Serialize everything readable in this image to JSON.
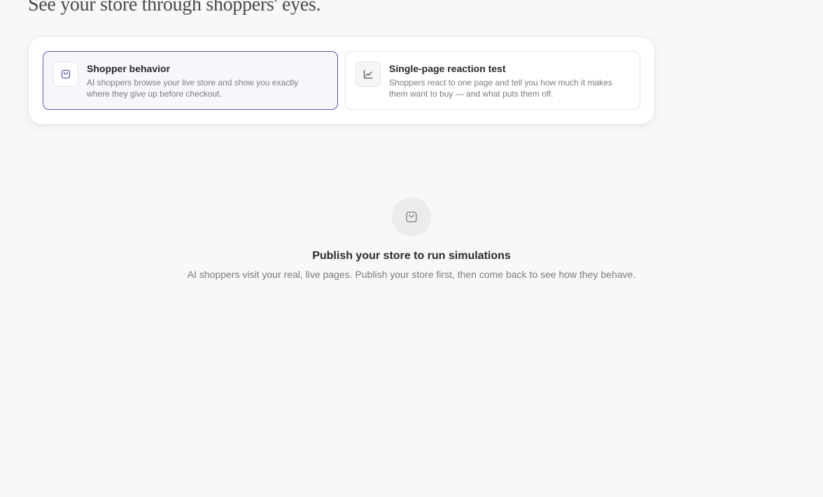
{
  "header": {
    "title": "See your store through shoppers' eyes."
  },
  "modes": [
    {
      "icon": "shopping-bag-icon",
      "title": "Shopper behavior",
      "description": "AI shoppers browse your live store and show you exactly where they give up before checkout.",
      "selected": true
    },
    {
      "icon": "line-chart-icon",
      "title": "Single-page reaction test",
      "description": "Shoppers react to one page and tell you how much it makes them want to buy — and what puts them off.",
      "selected": false
    }
  ],
  "empty_state": {
    "icon": "shopping-bag-icon",
    "title": "Publish your store to run simulations",
    "description": "AI shoppers visit your real, live pages. Publish your store first, then come back to see how they behave."
  },
  "colors": {
    "accent": "#5a5aa8",
    "selected_background": "#f6f6fd",
    "background": "#f8f8f8"
  }
}
